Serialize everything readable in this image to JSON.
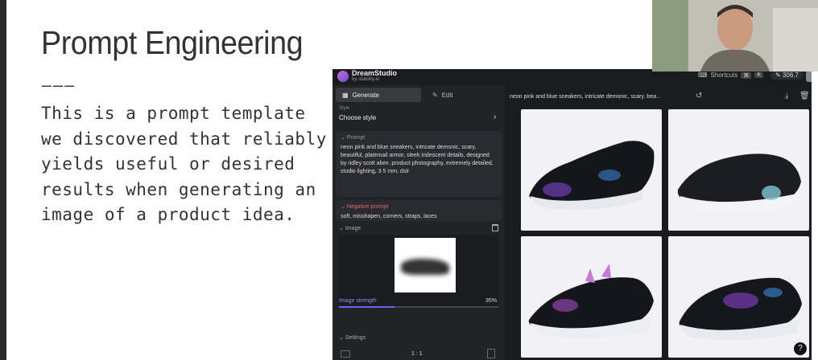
{
  "slide": {
    "title": "Prompt Engineering",
    "divider": "———",
    "body": "This is a prompt template we discovered that reliably yields useful or desired results when generating an image of a product idea."
  },
  "dreamstudio": {
    "brand": "DreamStudio",
    "brand_sub": "by stability.ai",
    "shortcuts_label": "Shortcuts",
    "shortcut_keys": [
      "⌘",
      "K"
    ],
    "credits": "306.7",
    "tabs": [
      {
        "label": "Generate",
        "icon": "generate-icon",
        "active": true
      },
      {
        "label": "Edit",
        "icon": "edit-icon",
        "active": false
      }
    ],
    "style": {
      "label": "Style",
      "value": "Choose style"
    },
    "prompt": {
      "label": "Prompt",
      "text": "neon pink and blue sneakers, intricate demonic, scary, beautiful, platemail armor, sleek iridescent details, designed by ridley scott alien. product photography, extremely detailed, studio lighting, 3 5 mm, dslr"
    },
    "negative_prompt": {
      "label": "Negative prompt",
      "text": "soft, misshapen, corners, straps, laces"
    },
    "image": {
      "label": "Image",
      "strength_label": "Image strength",
      "strength_value": "35%",
      "strength": 0.35
    },
    "settings": {
      "label": "Settings",
      "aspect_ratio": "1 : 1"
    },
    "results": {
      "prompt_preview": "neon pink and blue sneakers, intricate demonic, scary, bea...",
      "images": [
        {
          "subject": "sneaker-black-iridescent"
        },
        {
          "subject": "sneaker-black-white"
        },
        {
          "subject": "sneaker-pink-spikes"
        },
        {
          "subject": "sneaker-purple-blue"
        }
      ]
    },
    "colors": {
      "accent": "#6b4fd6",
      "panel": "#222327",
      "background": "#1a1b1f"
    }
  },
  "help": "?"
}
